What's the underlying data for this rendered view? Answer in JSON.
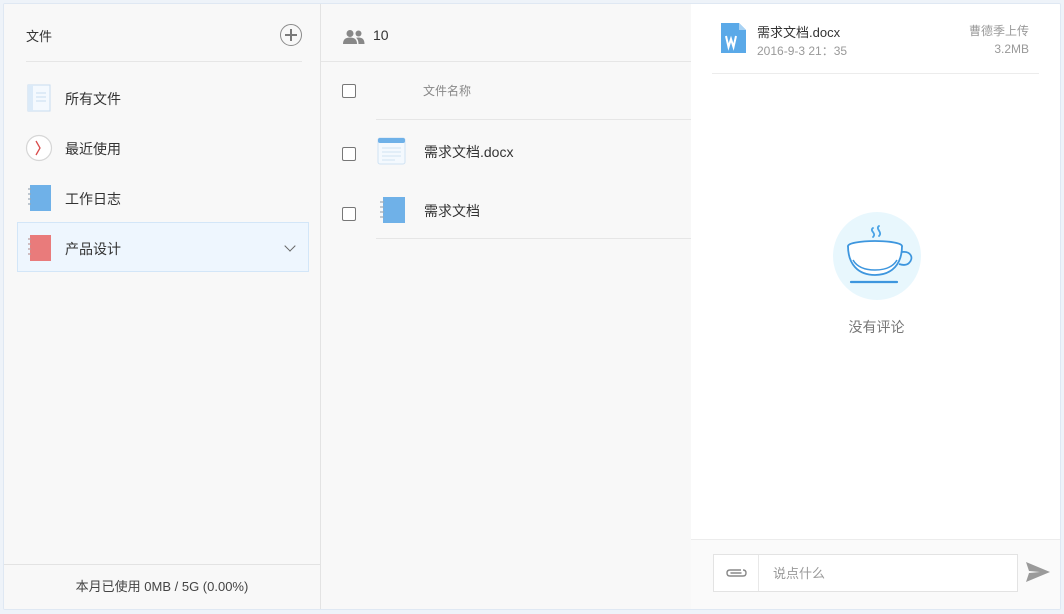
{
  "sidebar": {
    "title": "文件",
    "add_icon": "plus-circle-icon",
    "items": [
      {
        "label": "所有文件",
        "icon": "all-files-icon",
        "active": false
      },
      {
        "label": "最近使用",
        "icon": "clock-icon",
        "active": false
      },
      {
        "label": "工作日志",
        "icon": "blue-notebook-icon",
        "active": false
      },
      {
        "label": "产品设计",
        "icon": "red-notebook-icon",
        "active": true
      }
    ],
    "usage_text": "本月已使用 0MB / 5G (0.00%)"
  },
  "file_list": {
    "member_icon": "members-icon",
    "member_count": "10",
    "column_header": "文件名称",
    "files": [
      {
        "name": "需求文档.docx",
        "icon": "document-icon"
      },
      {
        "name": "需求文档",
        "icon": "notebook-icon"
      }
    ]
  },
  "detail": {
    "file_name": "需求文档.docx",
    "file_time": "2016-9-3   21：35",
    "uploader": "曹德季上传",
    "file_size": "3.2MB",
    "empty_icon": "coffee-cup-icon",
    "empty_text": "没有评论",
    "comment_placeholder": "说点什么",
    "attach_icon": "paperclip-icon",
    "send_icon": "send-icon"
  },
  "colors": {
    "accent_blue": "#5aa9e8",
    "active_bg": "#eef6fe",
    "notebook_red": "#e97b7b",
    "notebook_blue": "#6fb1e8"
  }
}
